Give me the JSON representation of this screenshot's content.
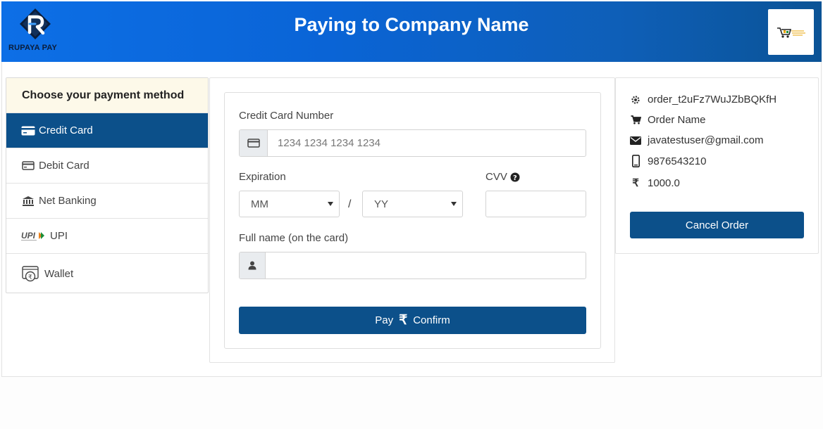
{
  "header": {
    "logo_text": "RUPAYA PAY",
    "title": "Paying to Company Name",
    "merchant_logo_icon": "shopping-cart-logo"
  },
  "methods": {
    "heading": "Choose your payment method",
    "items": [
      {
        "label": "Credit Card",
        "icon": "credit-card-icon",
        "active": true
      },
      {
        "label": "Debit Card",
        "icon": "debit-card-icon",
        "active": false
      },
      {
        "label": "Net Banking",
        "icon": "bank-icon",
        "active": false
      },
      {
        "label": "UPI",
        "icon": "upi-logo-icon",
        "active": false
      },
      {
        "label": "Wallet",
        "icon": "wallet-icon",
        "active": false
      }
    ]
  },
  "form": {
    "card_number_label": "Credit Card Number",
    "card_number_placeholder": "1234 1234 1234 1234",
    "expiration_label": "Expiration",
    "month_value": "MM",
    "separator": "/",
    "year_value": "YY",
    "cvv_label": "CVV",
    "fullname_label": "Full name (on the card)",
    "fullname_value": "",
    "pay_label": "Pay",
    "pay_symbol": "₹",
    "confirm_label": "Confirm"
  },
  "order": {
    "order_id": "order_t2uFz7WuJZbBQKfH",
    "order_name": "Order Name",
    "email": "javatestuser@gmail.com",
    "phone": "9876543210",
    "amount_symbol": "₹",
    "amount": "1000.0",
    "cancel_label": "Cancel Order"
  },
  "colors": {
    "primary": "#0c508a",
    "header_start": "#0d6fe6",
    "header_end": "#0b5396",
    "method_heading_bg": "#fdf9e9"
  }
}
